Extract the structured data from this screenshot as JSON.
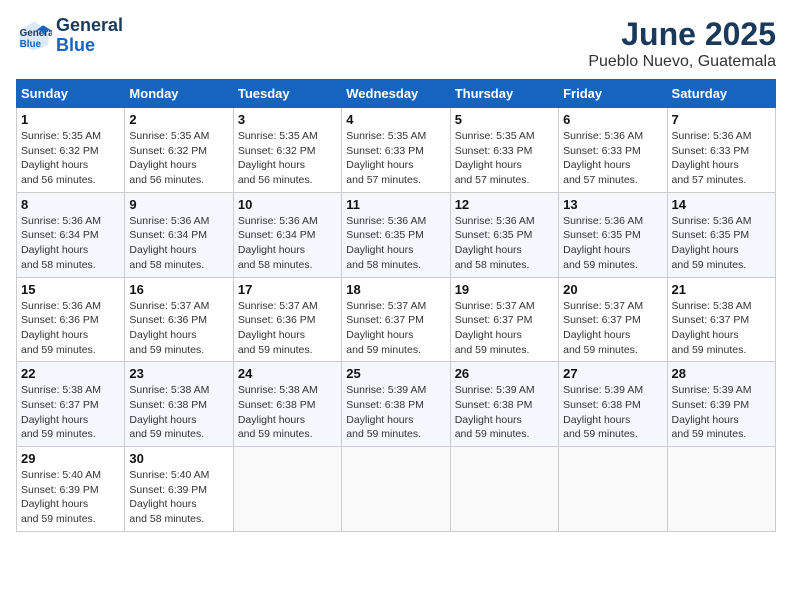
{
  "header": {
    "logo_line1": "General",
    "logo_line2": "Blue",
    "month": "June 2025",
    "location": "Pueblo Nuevo, Guatemala"
  },
  "weekdays": [
    "Sunday",
    "Monday",
    "Tuesday",
    "Wednesday",
    "Thursday",
    "Friday",
    "Saturday"
  ],
  "weeks": [
    [
      {
        "day": "1",
        "sunrise": "5:35 AM",
        "sunset": "6:32 PM",
        "daylight": "12 hours and 56 minutes."
      },
      {
        "day": "2",
        "sunrise": "5:35 AM",
        "sunset": "6:32 PM",
        "daylight": "12 hours and 56 minutes."
      },
      {
        "day": "3",
        "sunrise": "5:35 AM",
        "sunset": "6:32 PM",
        "daylight": "12 hours and 56 minutes."
      },
      {
        "day": "4",
        "sunrise": "5:35 AM",
        "sunset": "6:33 PM",
        "daylight": "12 hours and 57 minutes."
      },
      {
        "day": "5",
        "sunrise": "5:35 AM",
        "sunset": "6:33 PM",
        "daylight": "12 hours and 57 minutes."
      },
      {
        "day": "6",
        "sunrise": "5:36 AM",
        "sunset": "6:33 PM",
        "daylight": "12 hours and 57 minutes."
      },
      {
        "day": "7",
        "sunrise": "5:36 AM",
        "sunset": "6:33 PM",
        "daylight": "12 hours and 57 minutes."
      }
    ],
    [
      {
        "day": "8",
        "sunrise": "5:36 AM",
        "sunset": "6:34 PM",
        "daylight": "12 hours and 58 minutes."
      },
      {
        "day": "9",
        "sunrise": "5:36 AM",
        "sunset": "6:34 PM",
        "daylight": "12 hours and 58 minutes."
      },
      {
        "day": "10",
        "sunrise": "5:36 AM",
        "sunset": "6:34 PM",
        "daylight": "12 hours and 58 minutes."
      },
      {
        "day": "11",
        "sunrise": "5:36 AM",
        "sunset": "6:35 PM",
        "daylight": "12 hours and 58 minutes."
      },
      {
        "day": "12",
        "sunrise": "5:36 AM",
        "sunset": "6:35 PM",
        "daylight": "12 hours and 58 minutes."
      },
      {
        "day": "13",
        "sunrise": "5:36 AM",
        "sunset": "6:35 PM",
        "daylight": "12 hours and 59 minutes."
      },
      {
        "day": "14",
        "sunrise": "5:36 AM",
        "sunset": "6:35 PM",
        "daylight": "12 hours and 59 minutes."
      }
    ],
    [
      {
        "day": "15",
        "sunrise": "5:36 AM",
        "sunset": "6:36 PM",
        "daylight": "12 hours and 59 minutes."
      },
      {
        "day": "16",
        "sunrise": "5:37 AM",
        "sunset": "6:36 PM",
        "daylight": "12 hours and 59 minutes."
      },
      {
        "day": "17",
        "sunrise": "5:37 AM",
        "sunset": "6:36 PM",
        "daylight": "12 hours and 59 minutes."
      },
      {
        "day": "18",
        "sunrise": "5:37 AM",
        "sunset": "6:37 PM",
        "daylight": "12 hours and 59 minutes."
      },
      {
        "day": "19",
        "sunrise": "5:37 AM",
        "sunset": "6:37 PM",
        "daylight": "12 hours and 59 minutes."
      },
      {
        "day": "20",
        "sunrise": "5:37 AM",
        "sunset": "6:37 PM",
        "daylight": "12 hours and 59 minutes."
      },
      {
        "day": "21",
        "sunrise": "5:38 AM",
        "sunset": "6:37 PM",
        "daylight": "12 hours and 59 minutes."
      }
    ],
    [
      {
        "day": "22",
        "sunrise": "5:38 AM",
        "sunset": "6:37 PM",
        "daylight": "12 hours and 59 minutes."
      },
      {
        "day": "23",
        "sunrise": "5:38 AM",
        "sunset": "6:38 PM",
        "daylight": "12 hours and 59 minutes."
      },
      {
        "day": "24",
        "sunrise": "5:38 AM",
        "sunset": "6:38 PM",
        "daylight": "12 hours and 59 minutes."
      },
      {
        "day": "25",
        "sunrise": "5:39 AM",
        "sunset": "6:38 PM",
        "daylight": "12 hours and 59 minutes."
      },
      {
        "day": "26",
        "sunrise": "5:39 AM",
        "sunset": "6:38 PM",
        "daylight": "12 hours and 59 minutes."
      },
      {
        "day": "27",
        "sunrise": "5:39 AM",
        "sunset": "6:38 PM",
        "daylight": "12 hours and 59 minutes."
      },
      {
        "day": "28",
        "sunrise": "5:39 AM",
        "sunset": "6:39 PM",
        "daylight": "12 hours and 59 minutes."
      }
    ],
    [
      {
        "day": "29",
        "sunrise": "5:40 AM",
        "sunset": "6:39 PM",
        "daylight": "12 hours and 59 minutes."
      },
      {
        "day": "30",
        "sunrise": "5:40 AM",
        "sunset": "6:39 PM",
        "daylight": "12 hours and 58 minutes."
      },
      null,
      null,
      null,
      null,
      null
    ]
  ]
}
